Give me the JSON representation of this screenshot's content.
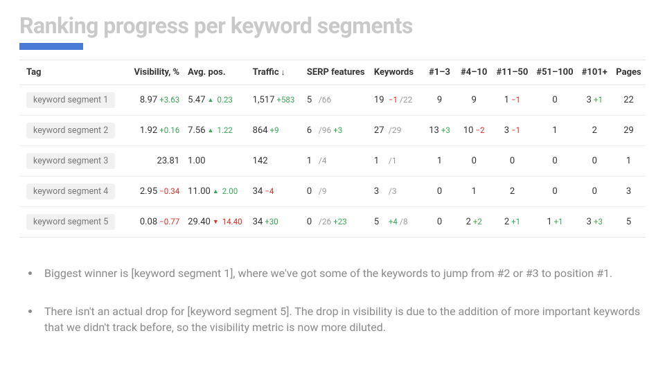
{
  "title": "Ranking progress per keyword segments",
  "columns": {
    "tag": "Tag",
    "visibility": "Visibility, %",
    "avg_pos": "Avg. pos.",
    "traffic": "Traffic",
    "serp": "SERP features",
    "keywords": "Keywords",
    "r1_3": "#1–3",
    "r4_10": "#4–10",
    "r11_50": "#11–50",
    "r51_100": "#51–100",
    "r101": "#101+",
    "pages": "Pages"
  },
  "rows": [
    {
      "tag": "keyword segment 1",
      "visibility": "8.97",
      "visibility_delta": "+3.63",
      "visibility_sign": "pos",
      "avg_pos": "5.47",
      "avg_pos_delta": "0.23",
      "avg_pos_dir": "up",
      "traffic": "1,517",
      "traffic_delta": "+583",
      "traffic_sign": "pos",
      "serp_main": "5",
      "serp_total": "/66",
      "serp_delta": "",
      "serp_sign": "",
      "kw_main": "19",
      "kw_delta": "−1",
      "kw_sign": "neg",
      "kw_total": "/22",
      "r1_3": "9",
      "r1_3_delta": "",
      "r1_3_sign": "",
      "r4_10": "9",
      "r4_10_delta": "",
      "r4_10_sign": "",
      "r11_50": "1",
      "r11_50_delta": "−1",
      "r11_50_sign": "neg",
      "r51_100": "0",
      "r51_100_delta": "",
      "r51_100_sign": "",
      "r101": "3",
      "r101_delta": "+1",
      "r101_sign": "pos",
      "pages": "22"
    },
    {
      "tag": "keyword segment 2",
      "visibility": "1.92",
      "visibility_delta": "+0.16",
      "visibility_sign": "pos",
      "avg_pos": "7.56",
      "avg_pos_delta": "1.22",
      "avg_pos_dir": "up",
      "traffic": "864",
      "traffic_delta": "+9",
      "traffic_sign": "pos",
      "serp_main": "6",
      "serp_total": "/96",
      "serp_delta": "+3",
      "serp_sign": "pos",
      "kw_main": "27",
      "kw_delta": "",
      "kw_sign": "",
      "kw_total": "/29",
      "r1_3": "13",
      "r1_3_delta": "+3",
      "r1_3_sign": "pos",
      "r4_10": "10",
      "r4_10_delta": "−2",
      "r4_10_sign": "neg",
      "r11_50": "3",
      "r11_50_delta": "−1",
      "r11_50_sign": "neg",
      "r51_100": "1",
      "r51_100_delta": "",
      "r51_100_sign": "",
      "r101": "2",
      "r101_delta": "",
      "r101_sign": "",
      "pages": "29"
    },
    {
      "tag": "keyword segment 3",
      "visibility": "23.81",
      "visibility_delta": "",
      "visibility_sign": "",
      "avg_pos": "1.00",
      "avg_pos_delta": "",
      "avg_pos_dir": "",
      "traffic": "142",
      "traffic_delta": "",
      "traffic_sign": "",
      "serp_main": "1",
      "serp_total": "/4",
      "serp_delta": "",
      "serp_sign": "",
      "kw_main": "1",
      "kw_delta": "",
      "kw_sign": "",
      "kw_total": "/1",
      "r1_3": "1",
      "r1_3_delta": "",
      "r1_3_sign": "",
      "r4_10": "0",
      "r4_10_delta": "",
      "r4_10_sign": "",
      "r11_50": "0",
      "r11_50_delta": "",
      "r11_50_sign": "",
      "r51_100": "0",
      "r51_100_delta": "",
      "r51_100_sign": "",
      "r101": "0",
      "r101_delta": "",
      "r101_sign": "",
      "pages": "1"
    },
    {
      "tag": "keyword segment 4",
      "visibility": "2.95",
      "visibility_delta": "−0.34",
      "visibility_sign": "neg",
      "avg_pos": "11.00",
      "avg_pos_delta": "2.00",
      "avg_pos_dir": "up",
      "traffic": "34",
      "traffic_delta": "−4",
      "traffic_sign": "neg",
      "serp_main": "0",
      "serp_total": "/9",
      "serp_delta": "",
      "serp_sign": "",
      "kw_main": "3",
      "kw_delta": "",
      "kw_sign": "",
      "kw_total": "/3",
      "r1_3": "0",
      "r1_3_delta": "",
      "r1_3_sign": "",
      "r4_10": "1",
      "r4_10_delta": "",
      "r4_10_sign": "",
      "r11_50": "2",
      "r11_50_delta": "",
      "r11_50_sign": "",
      "r51_100": "0",
      "r51_100_delta": "",
      "r51_100_sign": "",
      "r101": "0",
      "r101_delta": "",
      "r101_sign": "",
      "pages": "3"
    },
    {
      "tag": "keyword segment 5",
      "visibility": "0.08",
      "visibility_delta": "−0.77",
      "visibility_sign": "neg",
      "avg_pos": "29.40",
      "avg_pos_delta": "14.40",
      "avg_pos_dir": "down",
      "traffic": "34",
      "traffic_delta": "+30",
      "traffic_sign": "pos",
      "serp_main": "0",
      "serp_total": "/26",
      "serp_delta": "+23",
      "serp_sign": "pos",
      "kw_main": "5",
      "kw_delta": "+4",
      "kw_sign": "pos",
      "kw_total": "/8",
      "r1_3": "0",
      "r1_3_delta": "",
      "r1_3_sign": "",
      "r4_10": "2",
      "r4_10_delta": "+2",
      "r4_10_sign": "pos",
      "r11_50": "2",
      "r11_50_delta": "+1",
      "r11_50_sign": "pos",
      "r51_100": "1",
      "r51_100_delta": "+1",
      "r51_100_sign": "pos",
      "r101": "3",
      "r101_delta": "+3",
      "r101_sign": "pos",
      "pages": "5"
    }
  ],
  "bullets": [
    "Biggest winner is [keyword segment 1], where we've got some of the keywords to jump from #2 or #3 to position #1.",
    "There isn't an actual drop for [keyword segment 5]. The drop in visibility is due to the addition of more important keywords that we didn't track before, so the visibility metric is now more diluted."
  ],
  "chart_data": {
    "type": "table",
    "title": "Ranking progress per keyword segments",
    "columns": [
      "Tag",
      "Visibility, %",
      "Avg. pos.",
      "Traffic",
      "SERP features",
      "Keywords",
      "#1–3",
      "#4–10",
      "#11–50",
      "#51–100",
      "#101+",
      "Pages"
    ],
    "rows": [
      [
        "keyword segment 1",
        8.97,
        5.47,
        1517,
        "5/66",
        "19/22",
        9,
        9,
        1,
        0,
        3,
        22
      ],
      [
        "keyword segment 2",
        1.92,
        7.56,
        864,
        "6/96",
        "27/29",
        13,
        10,
        3,
        1,
        2,
        29
      ],
      [
        "keyword segment 3",
        23.81,
        1.0,
        142,
        "1/4",
        "1/1",
        1,
        0,
        0,
        0,
        0,
        1
      ],
      [
        "keyword segment 4",
        2.95,
        11.0,
        34,
        "0/9",
        "3/3",
        0,
        1,
        2,
        0,
        0,
        3
      ],
      [
        "keyword segment 5",
        0.08,
        29.4,
        34,
        "0/26",
        "5/8",
        0,
        2,
        2,
        1,
        3,
        5
      ]
    ]
  }
}
